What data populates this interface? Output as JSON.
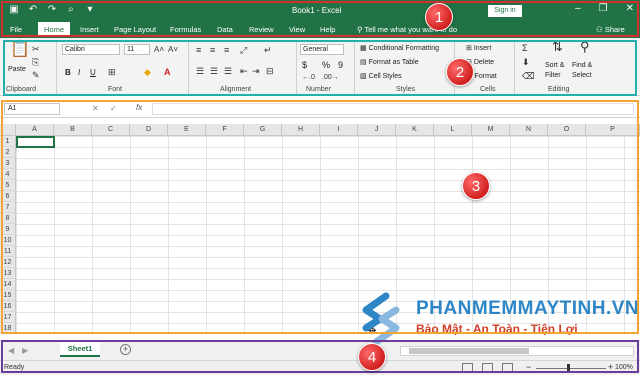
{
  "window": {
    "title": "Book1 - Excel",
    "signin": "Sign in",
    "controls": [
      "–",
      "❐",
      "✕"
    ]
  },
  "qat_icons": [
    "save-icon",
    "undo-icon",
    "redo-icon",
    "print-preview-icon",
    "customize-icon"
  ],
  "tabs": [
    {
      "label": "File"
    },
    {
      "label": "Home"
    },
    {
      "label": "Insert"
    },
    {
      "label": "Page Layout"
    },
    {
      "label": "Formulas"
    },
    {
      "label": "Data"
    },
    {
      "label": "Review"
    },
    {
      "label": "View"
    },
    {
      "label": "Help"
    }
  ],
  "active_tab": "Home",
  "tell_me": "Tell me what you want to do",
  "share": "Share",
  "ribbon": {
    "clipboard": {
      "label": "Clipboard",
      "paste": "Paste"
    },
    "font": {
      "label": "Font",
      "family": "Calibri",
      "size": "11",
      "bold": "B",
      "italic": "I",
      "underline": "U"
    },
    "alignment": {
      "label": "Alignment"
    },
    "number": {
      "label": "Number",
      "format": "General",
      "currency": "$",
      "percent": "%",
      "comma": "9"
    },
    "styles": {
      "label": "Styles",
      "conditional": "Conditional Formatting",
      "format_table": "Format as Table",
      "cell_styles": "Cell Styles"
    },
    "cells": {
      "label": "Cells",
      "insert": "Insert",
      "delete": "Delete",
      "format": "Format"
    },
    "editing": {
      "label": "Editing",
      "sort_filter": "Sort &",
      "sort_filter2": "Filter",
      "find_select": "Find &",
      "find_select2": "Select"
    }
  },
  "formula_bar": {
    "name_box": "A1",
    "fx": "fx",
    "value": ""
  },
  "columns": [
    "A",
    "B",
    "C",
    "D",
    "E",
    "F",
    "G",
    "H",
    "I",
    "J",
    "K",
    "L",
    "M",
    "N",
    "O",
    "P"
  ],
  "rows": [
    "1",
    "2",
    "3",
    "4",
    "5",
    "6",
    "7",
    "8",
    "9",
    "10",
    "11",
    "12",
    "13",
    "14",
    "15",
    "16",
    "17",
    "18"
  ],
  "active_cell": "A1",
  "sheets": [
    {
      "name": "Sheet1"
    }
  ],
  "status": {
    "ready": "Ready",
    "zoom": "100%"
  },
  "annotations": [
    "1",
    "2",
    "3",
    "4"
  ],
  "annotation_colors": {
    "1": "#d32f2f",
    "2": "#20b2aa",
    "3": "#f2a531",
    "4": "#6a3d9a"
  },
  "watermark": {
    "title": "PHANMEMMAYTINH.VN",
    "subtitle": "Bảo Mật - An Toàn - Tiện Lợi"
  }
}
